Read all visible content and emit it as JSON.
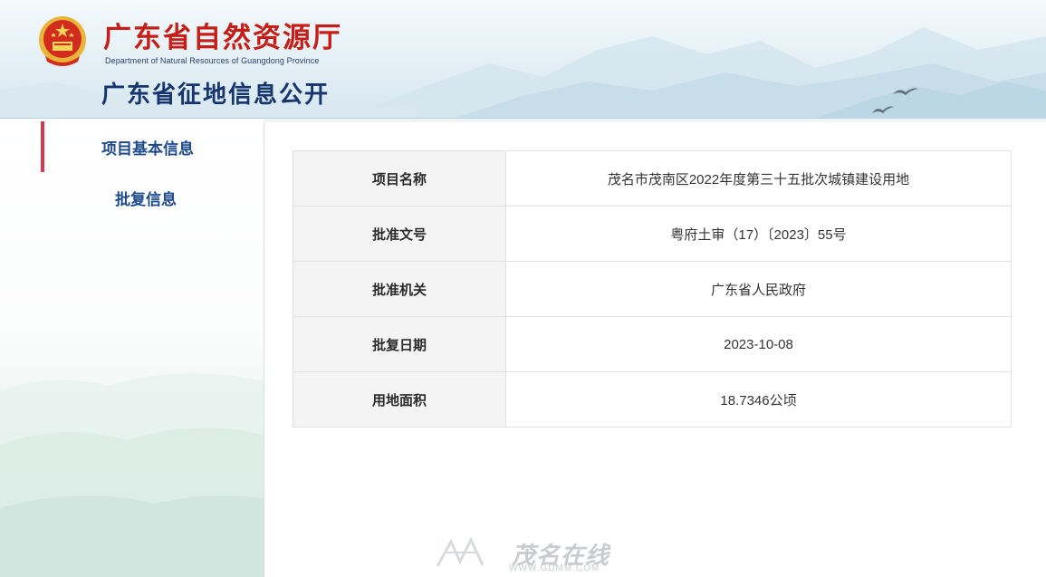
{
  "header": {
    "department_cn": "广东省自然资源厅",
    "department_en": "Department of Natural Resources of Guangdong Province",
    "site_title": "广东省征地信息公开"
  },
  "sidebar": {
    "items": [
      {
        "label": "项目基本信息",
        "active": true
      },
      {
        "label": "批复信息",
        "active": false
      }
    ]
  },
  "project": {
    "rows": [
      {
        "key": "项目名称",
        "value": "茂名市茂南区2022年度第三十五批次城镇建设用地"
      },
      {
        "key": "批准文号",
        "value": "粤府土审（17）〔2023〕55号"
      },
      {
        "key": "批准机关",
        "value": "广东省人民政府"
      },
      {
        "key": "批复日期",
        "value": "2023-10-08"
      },
      {
        "key": "用地面积",
        "value": "18.7346公顷"
      }
    ]
  },
  "watermark": {
    "text": "茂名在线",
    "url": "WWW.GDMM.COM"
  },
  "colors": {
    "brand_red": "#c61d16",
    "title_blue": "#16346e",
    "nav_blue": "#1f4a8c",
    "active_marker": "#d23a4e"
  }
}
